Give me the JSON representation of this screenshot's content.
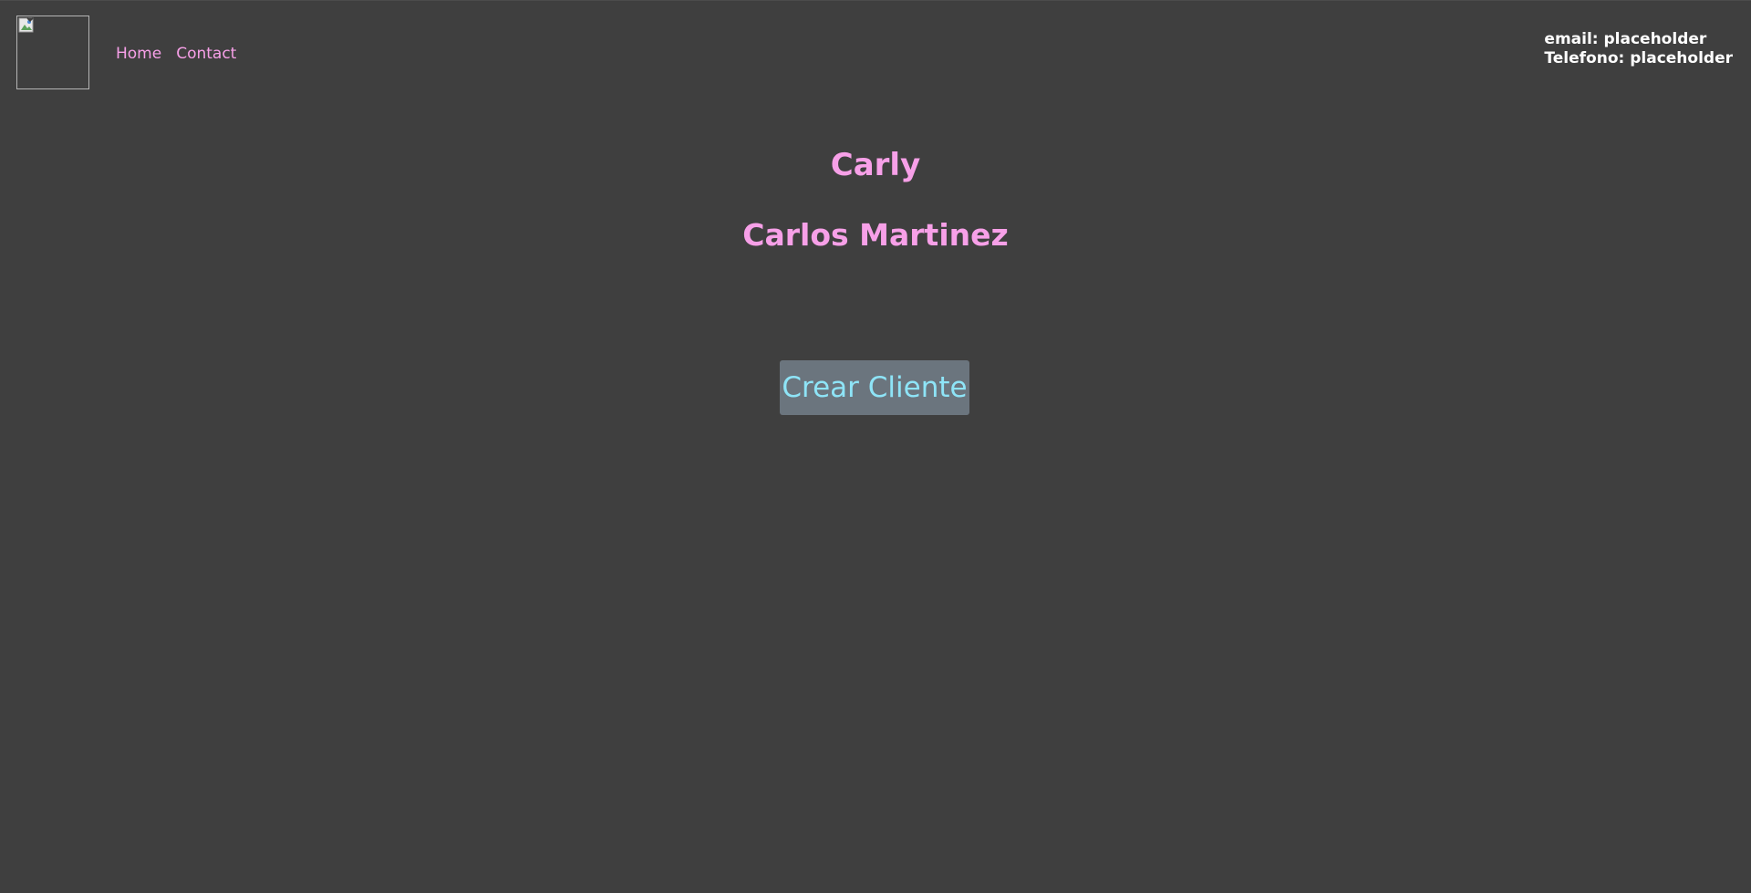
{
  "header": {
    "logo_alt": "",
    "nav": [
      {
        "label": "Home"
      },
      {
        "label": "Contact"
      }
    ],
    "contact": {
      "email_line": "email: placeholder",
      "phone_line": "Telefono: placeholder"
    }
  },
  "main": {
    "short_name": "Carly",
    "full_name": "Carlos Martinez",
    "create_button_label": "Crear Cliente"
  },
  "colors": {
    "background": "#3f3f3f",
    "accent_pink": "#f7a0e8",
    "button_bg": "#6b757e",
    "button_text": "#8ee4f7",
    "contact_text": "#ffffff"
  },
  "icons": {
    "logo": "broken-image-icon"
  }
}
